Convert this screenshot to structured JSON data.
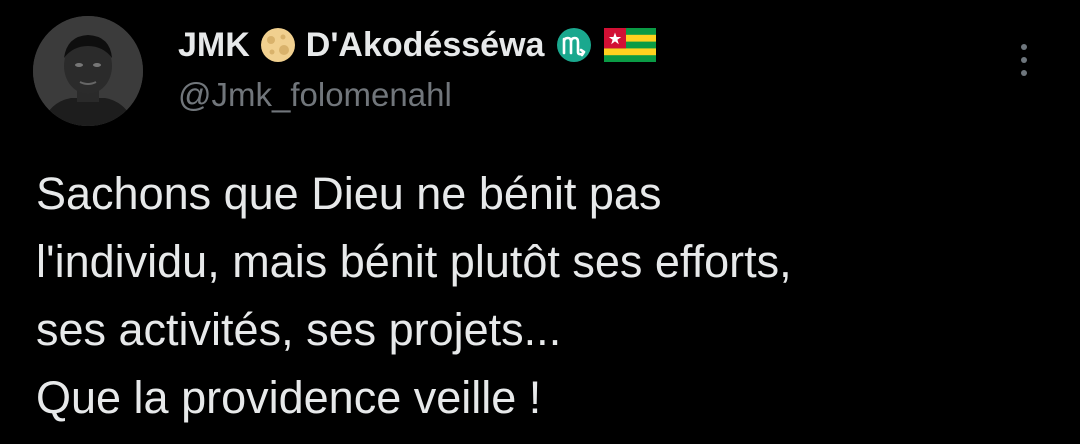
{
  "author": {
    "name_part1": "JMK",
    "name_part2": "D'Akodésséwa",
    "handle": "@Jmk_folomenahl",
    "emojis": {
      "moon": "full-moon-emoji",
      "zodiac": "scorpio-sign-emoji",
      "flag": "togo-flag-emoji"
    }
  },
  "tweet": {
    "lines": [
      "Sachons que Dieu ne bénit pas",
      "l'individu, mais bénit plutôt ses efforts,",
      "ses activités, ses projets...",
      "Que la providence veille !"
    ]
  },
  "colors": {
    "background": "#000000",
    "text": "#e7e9ea",
    "secondary": "#71767b",
    "zodiac_teal": "#1aa88e",
    "moon": "#f1d08f",
    "flag_green": "#0a9b45",
    "flag_yellow": "#ffd21f",
    "flag_red": "#d21034"
  }
}
